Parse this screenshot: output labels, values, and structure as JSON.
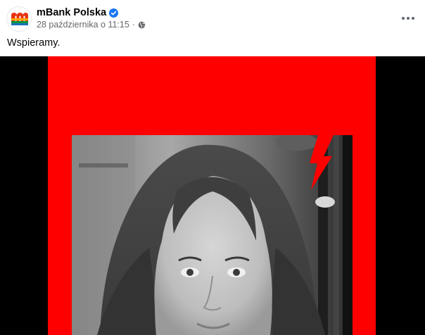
{
  "post": {
    "page_name": "mBank Polska",
    "timestamp": "28 października o 11:15",
    "separator": "·",
    "caption": "Wspieramy.",
    "audience_icon": "globe-icon",
    "verified_icon": "verified-badge-icon",
    "more_icon": "more-options-icon"
  },
  "colors": {
    "frame_red": "#ff0000",
    "background_black": "#000000",
    "verified_blue": "#1877f2",
    "meta_gray": "#65676b"
  }
}
